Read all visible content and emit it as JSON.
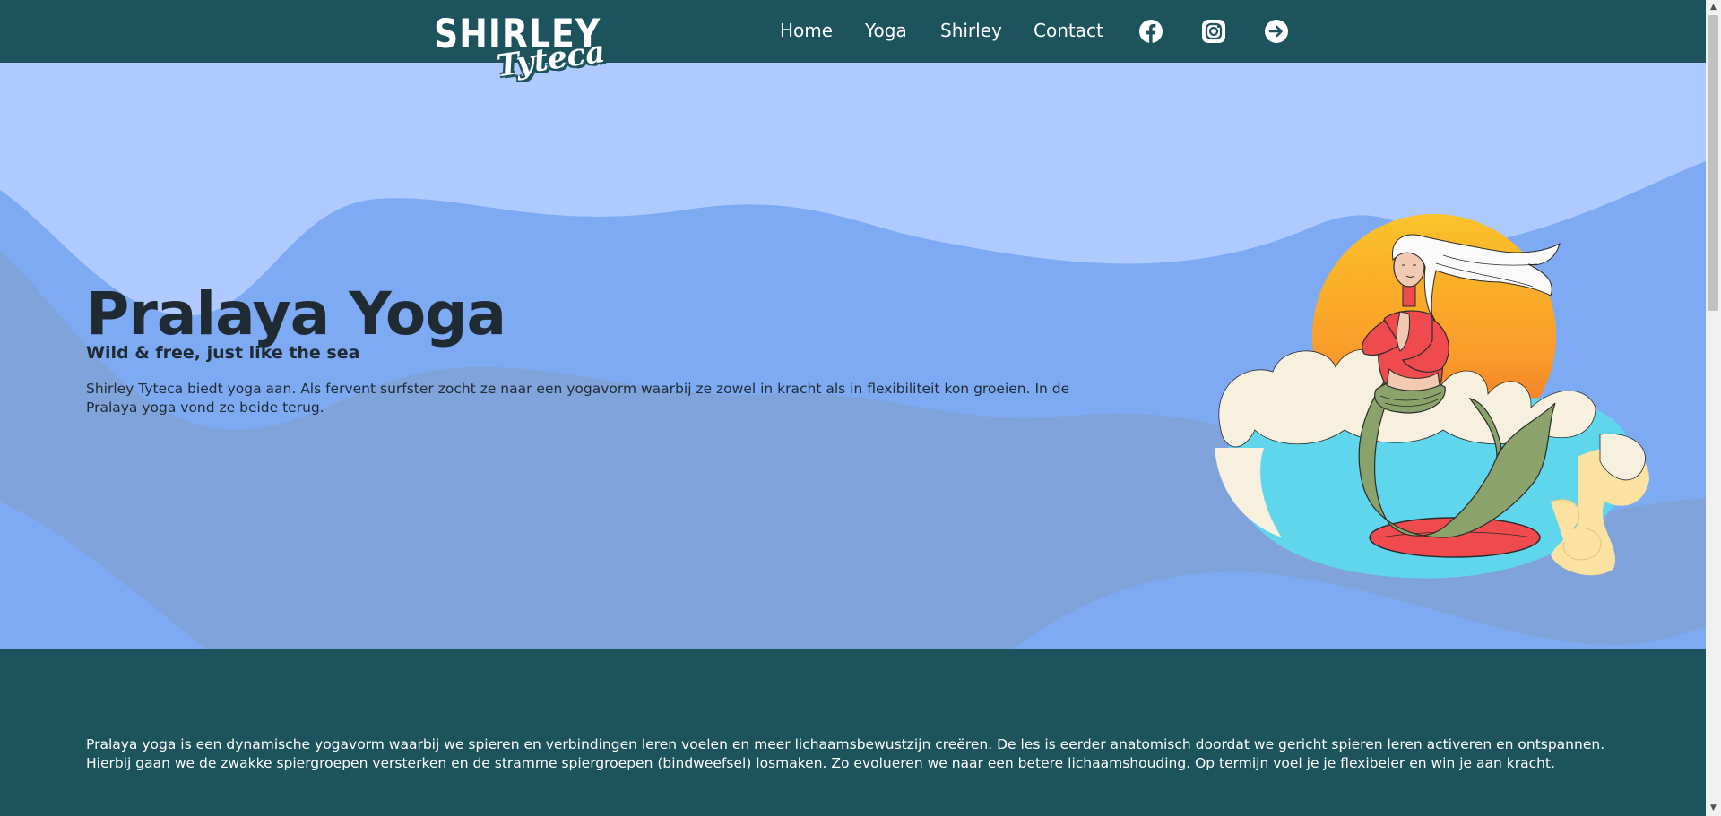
{
  "logo": {
    "line1": "SHIRLEY",
    "line2": "Tyteca"
  },
  "nav": {
    "items": [
      {
        "label": "Home"
      },
      {
        "label": "Yoga"
      },
      {
        "label": "Shirley"
      },
      {
        "label": "Contact"
      }
    ],
    "icons": [
      "facebook-icon",
      "instagram-icon",
      "login-arrow-icon"
    ]
  },
  "hero": {
    "title": "Pralaya Yoga",
    "subtitle": "Wild & free, just like the sea",
    "description": "Shirley Tyteca biedt yoga aan. Als fervent surfster zocht ze naar een yogavorm waarbij ze zowel in kracht als in flexibiliteit kon groeien. In de Pralaya yoga vond ze beide terug.",
    "illustration": "mermaid-surfer-illustration"
  },
  "info": {
    "text": "Pralaya yoga is een dynamische yogavorm waarbij we spieren en verbindingen leren voelen en meer lichaamsbewustzijn creëren. De les is eerder anatomisch doordat we gericht spieren leren activeren en ontspannen. Hierbij gaan we de zwakke spiergroepen versterken en de stramme spiergroepen (bindweefsel) losmaken. Zo evolueren we naar een betere lichaamshouding. Op termijn voel je je flexibeler en win je aan kracht."
  },
  "colors": {
    "header_bg": "#1c535c",
    "hero_sky": "#aecafe",
    "wave_mid": "#7eaaf4",
    "wave_dark": "#80a3dc",
    "text_dark": "#1f2a33"
  }
}
